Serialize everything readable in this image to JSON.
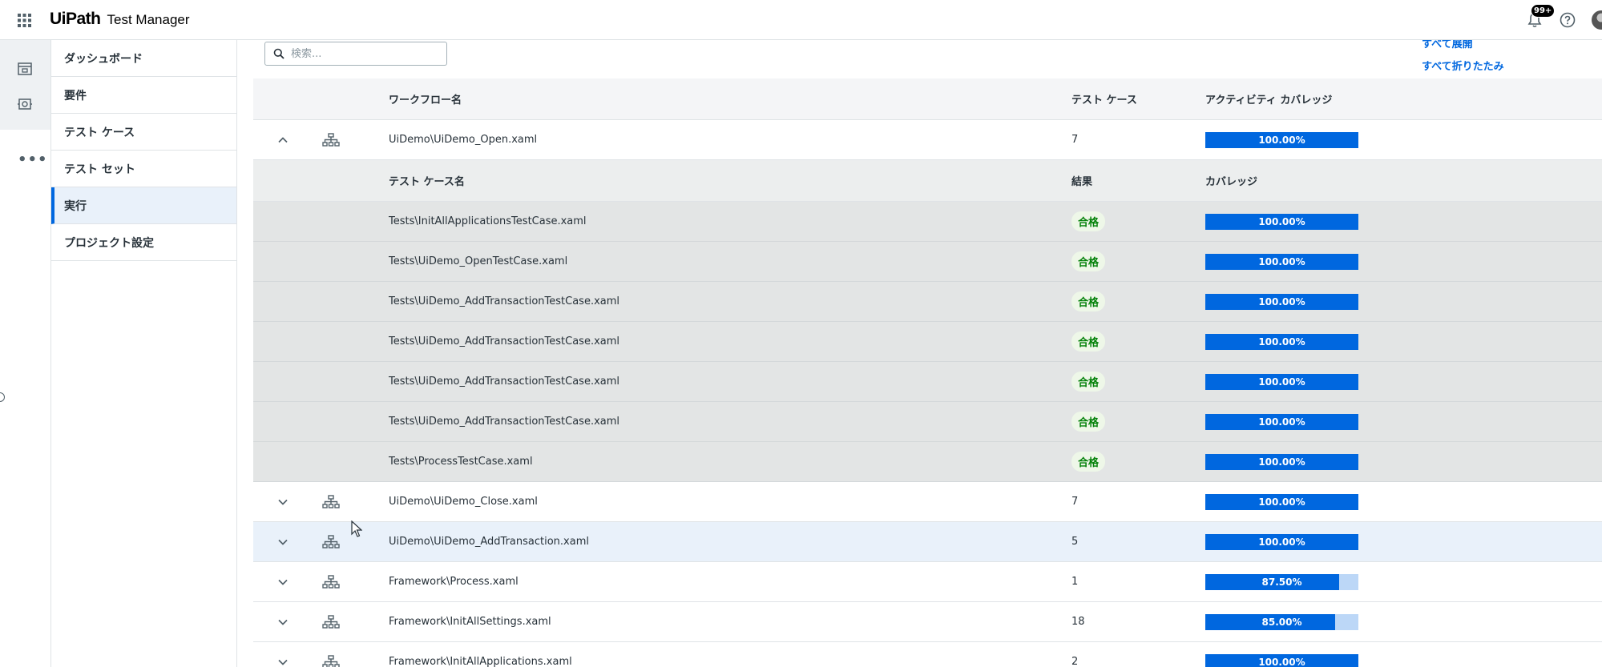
{
  "header": {
    "brand": "UiPath",
    "product": "Test Manager",
    "notification_count": "99+"
  },
  "sidebar": {
    "items": [
      {
        "label": "ダッシュボード",
        "active": false
      },
      {
        "label": "要件",
        "active": false
      },
      {
        "label": "テスト ケース",
        "active": false
      },
      {
        "label": "テスト セット",
        "active": false
      },
      {
        "label": "実行",
        "active": true
      },
      {
        "label": "プロジェクト設定",
        "active": false
      }
    ]
  },
  "toolbar": {
    "search_placeholder": "検索...",
    "expand_all": "すべて展開",
    "collapse_all": "すべて折りたたみ"
  },
  "table": {
    "columns": {
      "workflow": "ワークフロー名",
      "test_cases": "テスト ケース",
      "activity_coverage": "アクティビティ カバレッジ"
    },
    "sub_columns": {
      "test_case_name": "テスト ケース名",
      "result": "結果",
      "coverage": "カバレッジ"
    },
    "expanded_workflow": {
      "name": "UiDemo\\UiDemo_Open.xaml",
      "count": "7",
      "coverage_label": "100.00%",
      "coverage_value": 100
    },
    "test_cases": [
      {
        "name": "Tests\\InitAllApplicationsTestCase.xaml",
        "result": "合格",
        "coverage_label": "100.00%",
        "coverage_value": 100
      },
      {
        "name": "Tests\\UiDemo_OpenTestCase.xaml",
        "result": "合格",
        "coverage_label": "100.00%",
        "coverage_value": 100
      },
      {
        "name": "Tests\\UiDemo_AddTransactionTestCase.xaml",
        "result": "合格",
        "coverage_label": "100.00%",
        "coverage_value": 100
      },
      {
        "name": "Tests\\UiDemo_AddTransactionTestCase.xaml",
        "result": "合格",
        "coverage_label": "100.00%",
        "coverage_value": 100
      },
      {
        "name": "Tests\\UiDemo_AddTransactionTestCase.xaml",
        "result": "合格",
        "coverage_label": "100.00%",
        "coverage_value": 100
      },
      {
        "name": "Tests\\UiDemo_AddTransactionTestCase.xaml",
        "result": "合格",
        "coverage_label": "100.00%",
        "coverage_value": 100
      },
      {
        "name": "Tests\\ProcessTestCase.xaml",
        "result": "合格",
        "coverage_label": "100.00%",
        "coverage_value": 100
      }
    ],
    "workflows": [
      {
        "name": "UiDemo\\UiDemo_Close.xaml",
        "count": "7",
        "coverage_label": "100.00%",
        "coverage_value": 100
      },
      {
        "name": "UiDemo\\UiDemo_AddTransaction.xaml",
        "count": "5",
        "coverage_label": "100.00%",
        "coverage_value": 100
      },
      {
        "name": "Framework\\Process.xaml",
        "count": "1",
        "coverage_label": "87.50%",
        "coverage_value": 87.5
      },
      {
        "name": "Framework\\InitAllSettings.xaml",
        "count": "18",
        "coverage_label": "85.00%",
        "coverage_value": 85
      },
      {
        "name": "Framework\\InitAllApplications.xaml",
        "count": "2",
        "coverage_label": "100.00%",
        "coverage_value": 100
      }
    ]
  },
  "colors": {
    "accent": "#0067df",
    "bar_track": "#bcd7f7",
    "pass_text": "#038108",
    "pass_bg": "#eef7e8"
  }
}
